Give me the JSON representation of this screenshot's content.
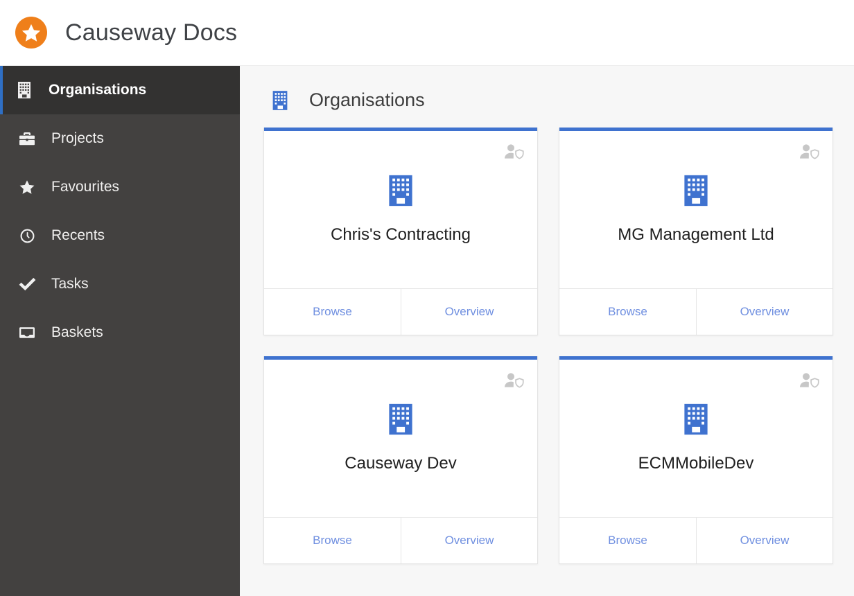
{
  "header": {
    "app_title": "Causeway Docs",
    "logo_icon": "star-badge-icon",
    "logo_color": "#ef7f1a"
  },
  "sidebar": {
    "background_color": "#434140",
    "active_accent_color": "#2f6fc4",
    "items": [
      {
        "label": "Organisations",
        "icon": "building-icon",
        "active": true
      },
      {
        "label": "Projects",
        "icon": "briefcase-icon",
        "active": false
      },
      {
        "label": "Favourites",
        "icon": "star-icon",
        "active": false
      },
      {
        "label": "Recents",
        "icon": "clock-icon",
        "active": false
      },
      {
        "label": "Tasks",
        "icon": "check-icon",
        "active": false
      },
      {
        "label": "Baskets",
        "icon": "inbox-icon",
        "active": false
      }
    ]
  },
  "main": {
    "page_title": "Organisations",
    "page_icon": "building-icon",
    "accent_color": "#3f72cf",
    "link_color": "#6f8fe0",
    "cards": [
      {
        "name": "Chris's Contracting",
        "icon": "building-icon",
        "badge_icon": "user-shield-icon",
        "actions": [
          {
            "label": "Browse"
          },
          {
            "label": "Overview"
          }
        ]
      },
      {
        "name": "MG Management Ltd",
        "icon": "building-icon",
        "badge_icon": "user-shield-icon",
        "actions": [
          {
            "label": "Browse"
          },
          {
            "label": "Overview"
          }
        ]
      },
      {
        "name": "Causeway Dev",
        "icon": "building-icon",
        "badge_icon": "user-shield-icon",
        "actions": [
          {
            "label": "Browse"
          },
          {
            "label": "Overview"
          }
        ]
      },
      {
        "name": "ECMMobileDev",
        "icon": "building-icon",
        "badge_icon": "user-shield-icon",
        "actions": [
          {
            "label": "Browse"
          },
          {
            "label": "Overview"
          }
        ]
      }
    ]
  }
}
